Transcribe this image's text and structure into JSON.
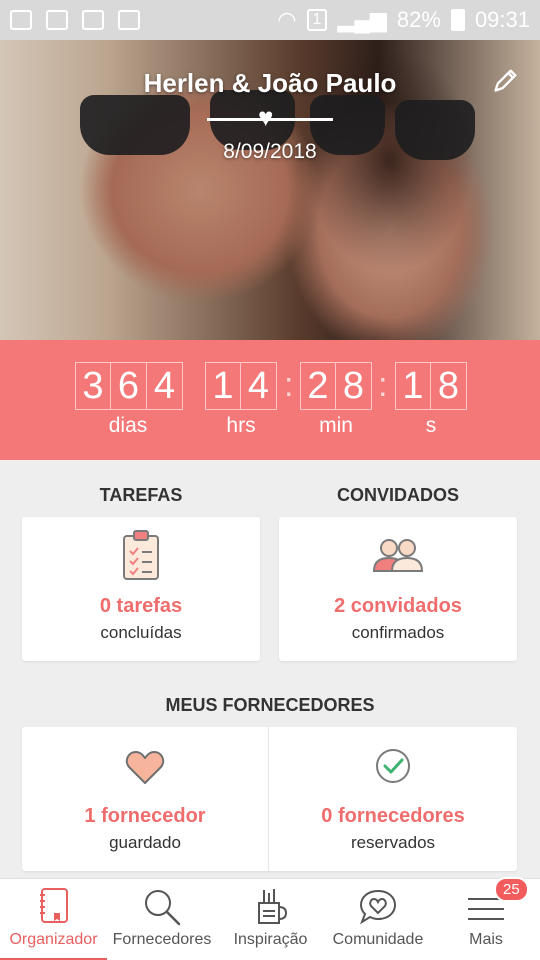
{
  "status_bar": {
    "battery": "82%",
    "time": "09:31",
    "sim": "1"
  },
  "hero": {
    "couple_names": "Herlen & João Paulo",
    "wedding_date": "8/09/2018"
  },
  "countdown": {
    "days": [
      "3",
      "6",
      "4"
    ],
    "hours": [
      "1",
      "4"
    ],
    "minutes": [
      "2",
      "8"
    ],
    "seconds": [
      "1",
      "8"
    ],
    "labels": {
      "days": "dias",
      "hours": "hrs",
      "minutes": "min",
      "seconds": "s"
    }
  },
  "tasks": {
    "section_title": "TAREFAS",
    "count_text": "0 tarefas",
    "status_text": "concluídas"
  },
  "guests": {
    "section_title": "CONVIDADOS",
    "count_text": "2 convidados",
    "status_text": "confirmados"
  },
  "vendors": {
    "section_title": "MEUS FORNECEDORES",
    "saved": {
      "count_text": "1 fornecedor",
      "status_text": "guardado"
    },
    "booked": {
      "count_text": "0 fornecedores",
      "status_text": "reservados"
    }
  },
  "bottom_nav": {
    "items": [
      {
        "label": "Organizador",
        "icon": "notebook-icon",
        "active": true
      },
      {
        "label": "Fornecedores",
        "icon": "search-icon"
      },
      {
        "label": "Inspiração",
        "icon": "pencil-cup-icon"
      },
      {
        "label": "Comunidade",
        "icon": "chat-heart-icon"
      },
      {
        "label": "Mais",
        "icon": "menu-icon",
        "badge": "25"
      }
    ]
  },
  "colors": {
    "accent": "#f57878",
    "accent_text": "#ef6d6d",
    "background": "#eeeeee"
  }
}
